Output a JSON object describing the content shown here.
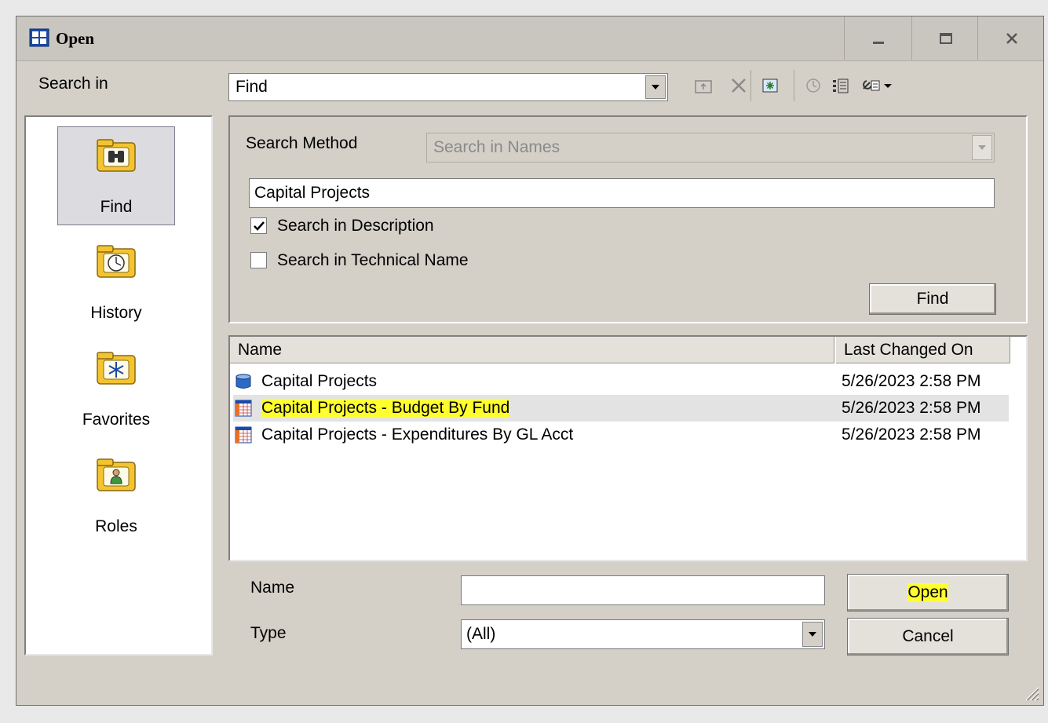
{
  "window": {
    "title": "Open",
    "controls": [
      "minimize",
      "maximize",
      "close"
    ]
  },
  "search_in": {
    "label": "Search in",
    "value": "Find"
  },
  "toolbar": {
    "icons": [
      "up-folder-icon",
      "delete-icon",
      "new-folder-icon",
      "refresh-icon",
      "details-view-icon",
      "tools-icon"
    ]
  },
  "sidebar": {
    "items": [
      {
        "label": "Find",
        "icon": "binoculars-icon",
        "selected": true
      },
      {
        "label": "History",
        "icon": "clock-icon",
        "selected": false
      },
      {
        "label": "Favorites",
        "icon": "star-icon",
        "selected": false
      },
      {
        "label": "Roles",
        "icon": "person-icon",
        "selected": false
      }
    ]
  },
  "search": {
    "method_label": "Search Method",
    "method_value": "Search in Names",
    "query": "Capital Projects",
    "description_label": "Search in Description",
    "description_checked": true,
    "technical_label": "Search in Technical Name",
    "technical_checked": false,
    "find_button": "Find"
  },
  "results": {
    "columns": [
      "Name",
      "Last Changed On"
    ],
    "rows": [
      {
        "name": "Capital Projects",
        "date": "5/26/2023 2:58 PM",
        "icon": "infoprovider-icon",
        "selected": false
      },
      {
        "name": "Capital Projects - Budget By Fund",
        "date": "5/26/2023 2:58 PM",
        "icon": "query-icon",
        "selected": true
      },
      {
        "name": "Capital Projects - Expenditures By  GL Acct",
        "date": "5/26/2023 2:58 PM",
        "icon": "query-icon",
        "selected": false
      }
    ]
  },
  "footer": {
    "name_label": "Name",
    "name_value": "",
    "type_label": "Type",
    "type_value": "(All)",
    "open_button": "Open",
    "cancel_button": "Cancel"
  },
  "colors": {
    "dialog_bg": "#d4d0c8",
    "highlight": "#ffff2e",
    "selected_row": "#e3e3e3"
  }
}
